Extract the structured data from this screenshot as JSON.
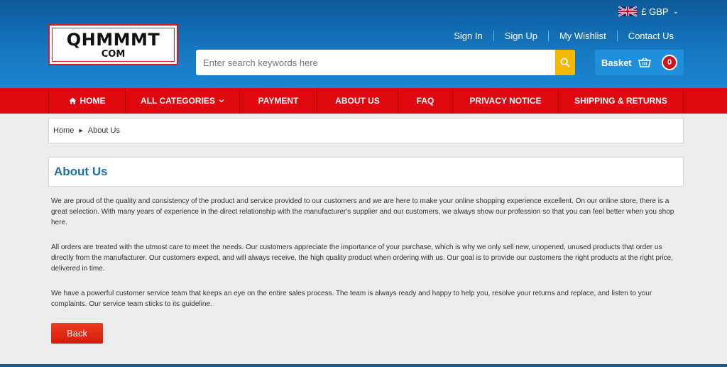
{
  "currency": {
    "label": "£ GBP"
  },
  "logo": {
    "main": "QHMMMT",
    "sub": "COM"
  },
  "top_links": [
    "Sign In",
    "Sign Up",
    "My Wishlist",
    "Contact Us"
  ],
  "search": {
    "placeholder": "Enter search keywords here"
  },
  "basket": {
    "label": "Basket",
    "count": "0"
  },
  "nav": {
    "items": [
      "HOME",
      "ALL CATEGORIES",
      "PAYMENT",
      "ABOUT US",
      "FAQ",
      "PRIVACY NOTICE",
      "SHIPPING & RETURNS"
    ]
  },
  "breadcrumb": {
    "home": "Home",
    "current": "About Us"
  },
  "page": {
    "title": "About Us",
    "paragraphs": [
      "We are proud of the quality and consistency of the product and service provided to our customers and we are here to make your online shopping experience excellent. On our online store, there is a great selection. With many years of experience in the direct relationship with the manufacturer's supplier and our customers, we always show our profession so that you can feel better when you shop here.",
      "All orders are treated with the utmost care to meet the needs. Our customers appreciate the importance of your purchase, which is why we only sell new, unopened, unused products that order us directly from the manufacturer. Our customers expect, and will always receive, the high quality product when ordering with us. Our goal is to provide our customers the right products at the right price, delivered in time.",
      "We have a powerful customer service team that keeps an eye on the entire sales process. The team is always ready and happy to help you, resolve your returns and replace, and listen to your complaints. Our service team sticks to its guideline."
    ],
    "back_label": "Back"
  },
  "colors": {
    "header_blue": "#1679c4",
    "nav_red": "#e0080f",
    "title_blue": "#1d6ea8",
    "search_yellow": "#f5b800"
  }
}
